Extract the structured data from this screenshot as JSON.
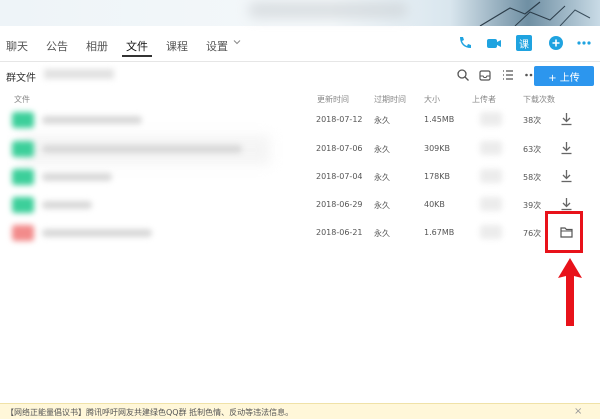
{
  "nav": {
    "tabs": [
      {
        "label": "聊天"
      },
      {
        "label": "公告"
      },
      {
        "label": "相册"
      },
      {
        "label": "文件"
      },
      {
        "label": "课程"
      },
      {
        "label": "设置"
      }
    ],
    "active_tab": "文件",
    "icons": [
      "phone-icon",
      "video-icon",
      "classroom-icon",
      "add-icon",
      "more-icon"
    ],
    "classroom_icon_text": "课"
  },
  "toolbar": {
    "title": "群文件",
    "icons": [
      "search-icon",
      "archive-icon",
      "list-view-icon",
      "more-icon"
    ],
    "upload_label": "+ 上传"
  },
  "table": {
    "headers": [
      "文件",
      "更新时间",
      "过期时间",
      "大小",
      "上传者",
      "下载次数"
    ],
    "rows": [
      {
        "updated": "2018-07-12",
        "expires": "永久",
        "size": "1.45MB",
        "downloads": "38次",
        "icon_color": "#3ccf9a",
        "action": "download-icon"
      },
      {
        "updated": "2018-07-06",
        "expires": "永久",
        "size": "309KB",
        "downloads": "63次",
        "icon_color": "#3ccf9a",
        "action": "download-icon"
      },
      {
        "updated": "2018-07-04",
        "expires": "永久",
        "size": "178KB",
        "downloads": "58次",
        "icon_color": "#3ccf9a",
        "action": "download-icon"
      },
      {
        "updated": "2018-06-29",
        "expires": "永久",
        "size": "40KB",
        "downloads": "39次",
        "icon_color": "#3ccf9a",
        "action": "download-icon"
      },
      {
        "updated": "2018-06-21",
        "expires": "永久",
        "size": "1.67MB",
        "downloads": "76次",
        "icon_color": "#f28b8b",
        "action": "folder-icon"
      }
    ]
  },
  "notice": {
    "text": "【网络正能量倡议书】腾讯呼吁网友共建绿色QQ群 抵制色情、反动等违法信息。",
    "close": "×"
  },
  "colors": {
    "accent": "#2c96ee",
    "highlight": "#e8121a",
    "nav_icon": "#1fa3e0"
  }
}
